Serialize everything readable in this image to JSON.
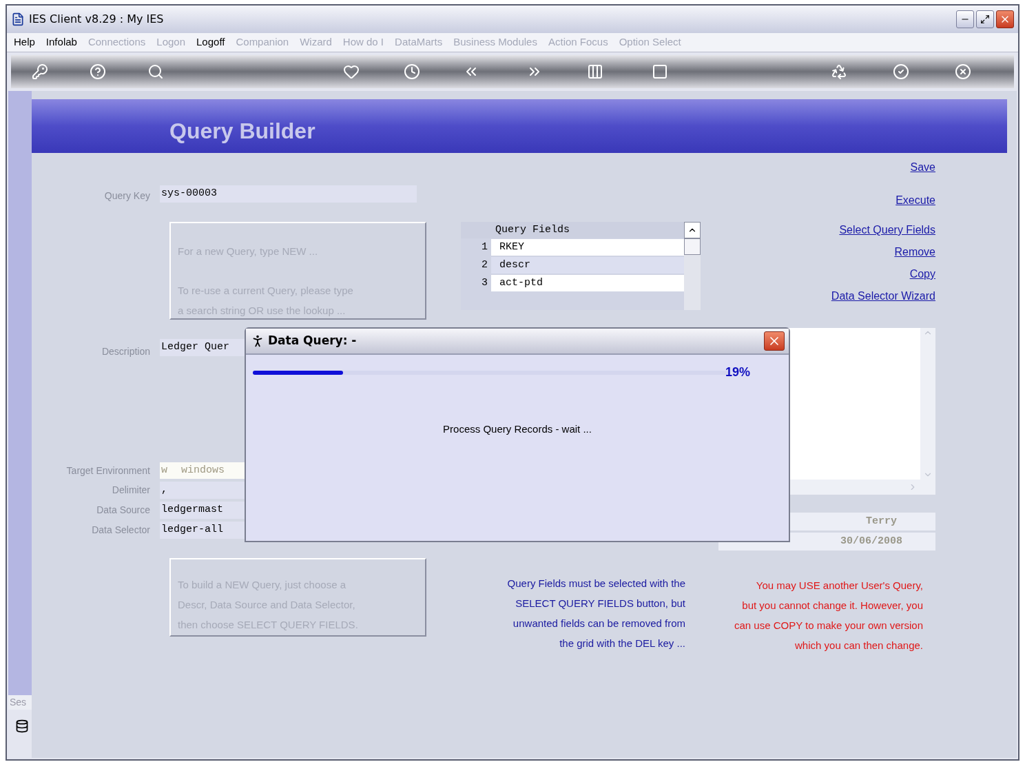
{
  "window": {
    "title": "IES Client v8.29 : My IES"
  },
  "menu": [
    {
      "label": "Help",
      "disabled": false
    },
    {
      "label": "Infolab",
      "disabled": false
    },
    {
      "label": "Connections",
      "disabled": true
    },
    {
      "label": "Logon",
      "disabled": true
    },
    {
      "label": "Logoff",
      "disabled": false
    },
    {
      "label": "Companion",
      "disabled": true
    },
    {
      "label": "Wizard",
      "disabled": true
    },
    {
      "label": "How do I",
      "disabled": true
    },
    {
      "label": "DataMarts",
      "disabled": true
    },
    {
      "label": "Business Modules",
      "disabled": true
    },
    {
      "label": "Action Focus",
      "disabled": true
    },
    {
      "label": "Option Select",
      "disabled": true
    }
  ],
  "toolbar": [
    {
      "kind": "key"
    },
    {
      "kind": "help"
    },
    {
      "kind": "search"
    },
    {
      "kind": "heart"
    },
    {
      "kind": "clock"
    },
    {
      "kind": "back"
    },
    {
      "kind": "forward"
    },
    {
      "kind": "pillar"
    },
    {
      "kind": "chip"
    },
    {
      "kind": "recycle"
    },
    {
      "kind": "check"
    },
    {
      "kind": "close"
    }
  ],
  "page": {
    "title": "Query Builder"
  },
  "links": {
    "save": "Save",
    "execute": "Execute",
    "actions": [
      "Select Query Fields",
      "Remove",
      "Copy",
      "Data Selector Wizard"
    ]
  },
  "query_key": {
    "label": "Query Key",
    "value": "sys-00003"
  },
  "hint_top": [
    "For a new Query, type NEW ...",
    "To re-use a current Query, please type",
    "a search string OR use the lookup ..."
  ],
  "description": {
    "label": "Description",
    "value": "Ledger Quer"
  },
  "target_environment": {
    "label": "Target Environment",
    "code": "w",
    "value": "windows"
  },
  "delimiter": {
    "label": "Delimiter",
    "value": ","
  },
  "data_source": {
    "label": "Data Source",
    "value": "ledgermast"
  },
  "data_selector": {
    "label": "Data Selector",
    "value": "ledger-all"
  },
  "hint_bottom": [
    "To build a NEW Query, just choose a",
    "Descr, Data Source and Data Selector,",
    "then choose SELECT QUERY FIELDS."
  ],
  "query_fields": {
    "heading": "Query Fields",
    "rows": [
      {
        "number": "1",
        "field": "RKEY"
      },
      {
        "number": "2",
        "field": "descr"
      },
      {
        "number": "3",
        "field": "act-ptd"
      }
    ]
  },
  "owner": {
    "user": "Terry",
    "updated": "30/06/2008"
  },
  "note_blue": [
    "Query Fields must be selected with the",
    "SELECT QUERY FIELDS button, but",
    "unwanted fields can be removed from",
    "the grid with the DEL key ..."
  ],
  "note_red": [
    "You may USE another User's Query,",
    "but you cannot change it. However, you",
    "can use COPY to make your own version",
    "which you can then change."
  ],
  "side_tab": {
    "label": "Ses"
  },
  "dialog": {
    "title": "Data Query: -",
    "progress": {
      "level": 0.19,
      "reading": "19%"
    },
    "message": "Process Query Records - wait ..."
  }
}
